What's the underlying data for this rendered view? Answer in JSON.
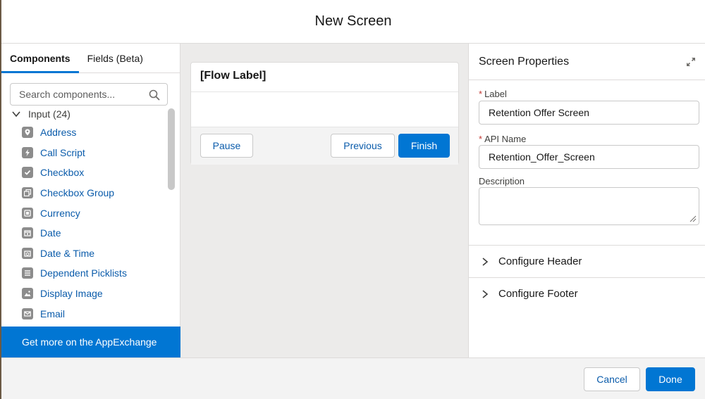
{
  "modal": {
    "title": "New Screen",
    "cancel_label": "Cancel",
    "done_label": "Done"
  },
  "left_panel": {
    "tabs": [
      {
        "label": "Components",
        "active": true
      },
      {
        "label": "Fields (Beta)",
        "active": false
      }
    ],
    "search_placeholder": "Search components...",
    "group": {
      "label": "Input (24)",
      "expanded": true
    },
    "items": [
      {
        "label": "Address",
        "icon": "location-pin-icon"
      },
      {
        "label": "Call Script",
        "icon": "lightning-icon"
      },
      {
        "label": "Checkbox",
        "icon": "checkbox-icon"
      },
      {
        "label": "Checkbox Group",
        "icon": "checkbox-group-icon"
      },
      {
        "label": "Currency",
        "icon": "currency-icon"
      },
      {
        "label": "Date",
        "icon": "calendar-icon"
      },
      {
        "label": "Date & Time",
        "icon": "calendar-time-icon"
      },
      {
        "label": "Dependent Picklists",
        "icon": "list-icon"
      },
      {
        "label": "Display Image",
        "icon": "image-icon"
      },
      {
        "label": "Email",
        "icon": "email-icon"
      }
    ],
    "appexchange_label": "Get more on the AppExchange"
  },
  "canvas": {
    "card_title": "[Flow Label]",
    "pause_label": "Pause",
    "previous_label": "Previous",
    "finish_label": "Finish"
  },
  "properties": {
    "title": "Screen Properties",
    "label_field": {
      "label": "Label",
      "value": "Retention Offer Screen",
      "required": true
    },
    "api_field": {
      "label": "API Name",
      "value": "Retention_Offer_Screen",
      "required": true
    },
    "description_field": {
      "label": "Description",
      "value": ""
    },
    "sections": [
      {
        "label": "Configure Header"
      },
      {
        "label": "Configure Footer"
      }
    ]
  },
  "colors": {
    "brand": "#0176d3",
    "link": "#0b5cab",
    "required": "#c23934"
  }
}
